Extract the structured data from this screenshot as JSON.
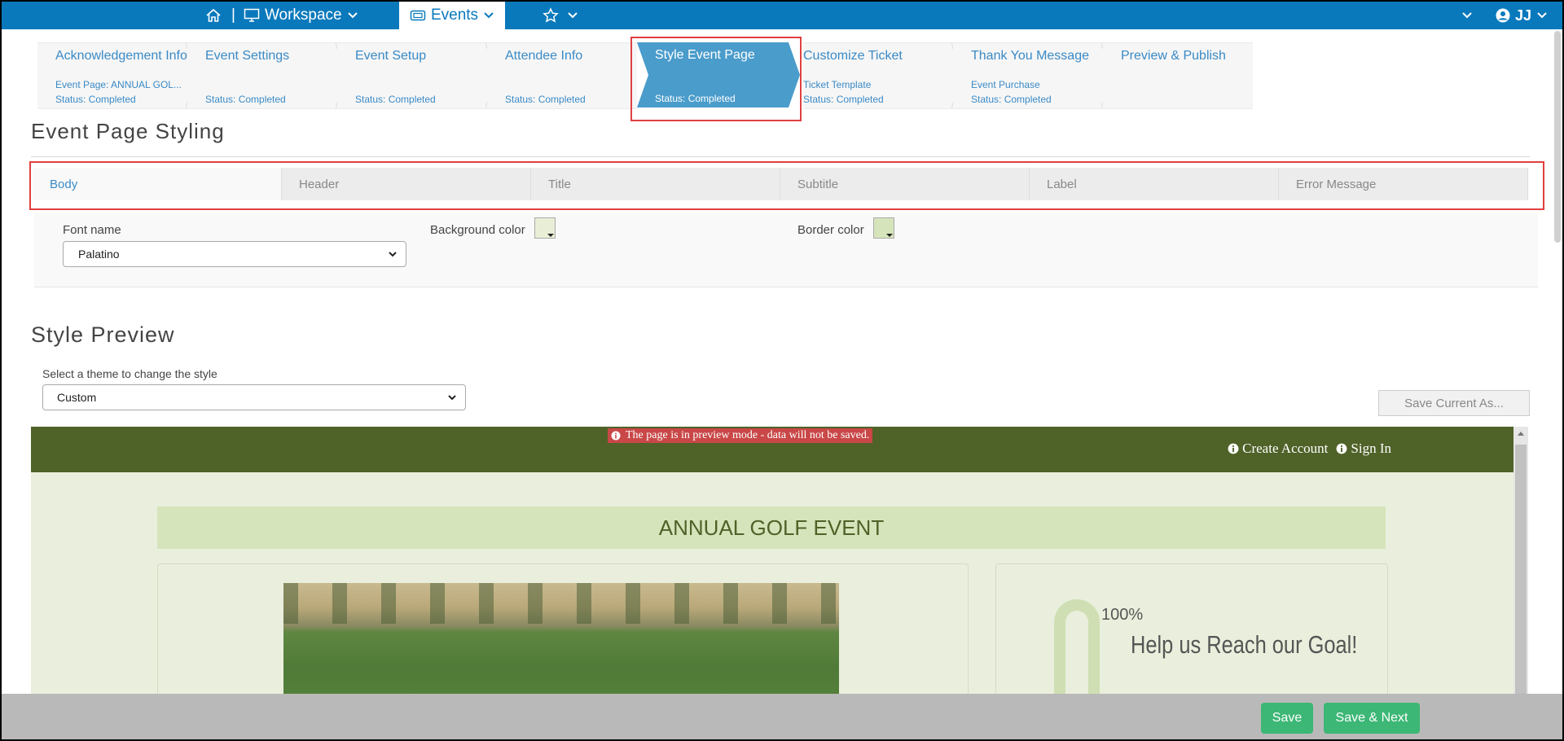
{
  "nav": {
    "workspace_label": "Workspace",
    "events_label": "Events",
    "user_initials": "JJ",
    "separator": "|",
    "icons": [
      "home-icon",
      "monitor-icon",
      "ticket-icon",
      "star-icon",
      "user-circle-icon",
      "chevron-down-icon"
    ]
  },
  "steps": [
    {
      "title": "Acknowledgement Info",
      "sub": "Event Page: ANNUAL GOL...",
      "status": "Status: Completed"
    },
    {
      "title": "Event Settings",
      "sub": "",
      "status": "Status: Completed"
    },
    {
      "title": "Event Setup",
      "sub": "",
      "status": "Status: Completed"
    },
    {
      "title": "Attendee Info",
      "sub": "",
      "status": "Status: Completed"
    },
    {
      "title": "Style Event Page",
      "sub": "",
      "status": "Status: Completed",
      "active": true
    },
    {
      "title": "Customize Ticket",
      "sub": "Ticket Template",
      "status": "Status: Completed"
    },
    {
      "title": "Thank You Message",
      "sub": "Event Purchase",
      "status": "Status: Completed"
    },
    {
      "title": "Preview & Publish",
      "sub": "",
      "status": ""
    }
  ],
  "styling": {
    "heading": "Event Page Styling",
    "tabs": [
      "Body",
      "Header",
      "Title",
      "Subtitle",
      "Label",
      "Error Message"
    ],
    "active_tab": "Body",
    "font_label": "Font name",
    "font_value": "Palatino",
    "bg_color_label": "Background color",
    "border_color_label": "Border color",
    "bg_color": "#e8efd6",
    "border_color": "#d6e4bb"
  },
  "preview": {
    "heading": "Style Preview",
    "theme_label": "Select a theme to change the style",
    "theme_value": "Custom",
    "save_as_label": "Save Current As...",
    "notice": "The page is in preview mode - data will not be saved.",
    "create_account": "Create Account",
    "sign_in": "Sign In",
    "event_title": "ANNUAL GOLF EVENT",
    "progress_pct": "100%",
    "goal_text": "Help us Reach our Goal!",
    "header_color": "#4f6228",
    "accent_color": "#d6e4bb"
  },
  "footer": {
    "save_label": "Save",
    "save_next_label": "Save & Next"
  },
  "colors": {
    "brand_blue": "#0a79bc",
    "active_step": "#4a9ccb",
    "success_green": "#3cb775",
    "highlight_red": "#e04040"
  }
}
